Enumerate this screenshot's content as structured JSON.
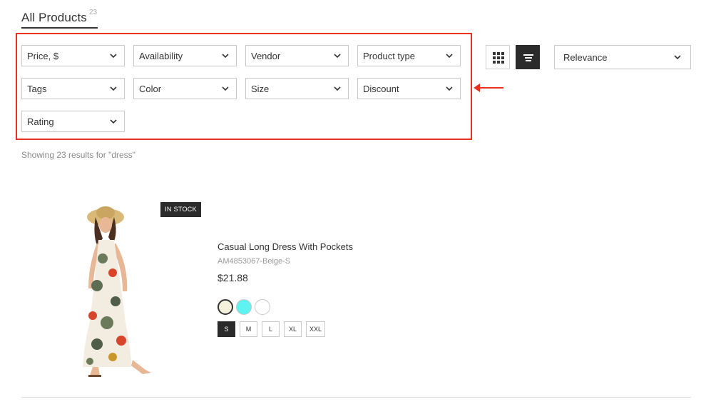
{
  "header": {
    "title": "All Products",
    "count": "23"
  },
  "filters": [
    {
      "label": "Price, $"
    },
    {
      "label": "Availability"
    },
    {
      "label": "Vendor"
    },
    {
      "label": "Product type"
    },
    {
      "label": "Tags"
    },
    {
      "label": "Color"
    },
    {
      "label": "Size"
    },
    {
      "label": "Discount"
    },
    {
      "label": "Rating"
    }
  ],
  "view": {
    "active": "list"
  },
  "sort": {
    "selected": "Relevance"
  },
  "results_text": "Showing 23 results for \"dress\"",
  "product": {
    "badge": "IN STOCK",
    "title": "Casual Long Dress With Pockets",
    "sku": "AM4853067-Beige-S",
    "price": "$21.88",
    "swatches": [
      "#f4f1dc",
      "#5ef2f0",
      "#ffffff"
    ],
    "sizes": [
      "S",
      "M",
      "L",
      "XL",
      "XXL"
    ],
    "selected_size": "S"
  },
  "annotation_color": "#e8321c"
}
